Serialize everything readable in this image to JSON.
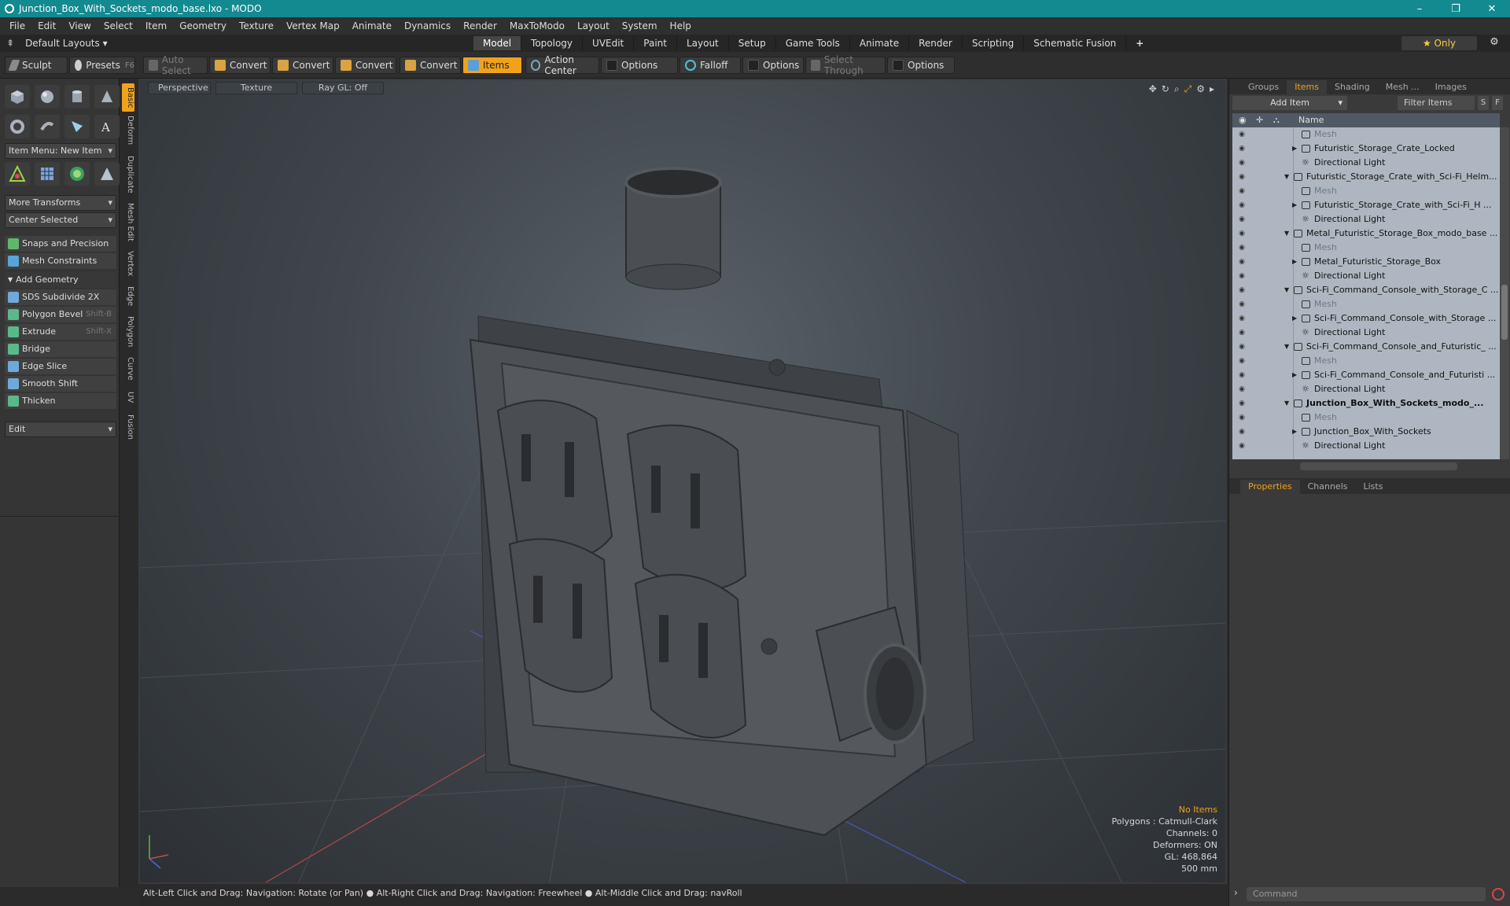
{
  "window": {
    "title": "Junction_Box_With_Sockets_modo_base.lxo - MODO",
    "minimize": "–",
    "maximize": "❐",
    "close": "✕"
  },
  "menu": [
    "File",
    "Edit",
    "View",
    "Select",
    "Item",
    "Geometry",
    "Texture",
    "Vertex Map",
    "Animate",
    "Dynamics",
    "Render",
    "MaxToModo",
    "Layout",
    "System",
    "Help"
  ],
  "layout_bar": {
    "default_layouts": "Default Layouts ▾",
    "tabs": [
      "Model",
      "Topology",
      "UVEdit",
      "Paint",
      "Layout",
      "Setup",
      "Game Tools",
      "Animate",
      "Render",
      "Scripting",
      "Schematic Fusion"
    ],
    "active_tab": "Model",
    "add": "+",
    "only": "★  Only"
  },
  "toolbar": {
    "sculpt": "Sculpt",
    "presets": "Presets",
    "presets_key": "F6",
    "auto_select": "Auto Select",
    "convert1": "Convert",
    "convert2": "Convert",
    "convert3": "Convert",
    "convert4": "Convert",
    "items": "Items",
    "action_center": "Action Center",
    "options1": "Options",
    "falloff": "Falloff",
    "options2": "Options",
    "select_through": "Select Through",
    "options3": "Options"
  },
  "left_panel": {
    "item_menu": "Item Menu: New Item",
    "more_transforms": "More Transforms",
    "center_selected": "Center Selected",
    "snaps": "Snaps and Precision",
    "mesh_constraints": "Mesh Constraints",
    "add_geometry": "Add Geometry",
    "tools": [
      {
        "label": "SDS Subdivide 2X",
        "shortcut": ""
      },
      {
        "label": "Polygon Bevel",
        "shortcut": "Shift-B"
      },
      {
        "label": "Extrude",
        "shortcut": "Shift-X"
      },
      {
        "label": "Bridge",
        "shortcut": ""
      },
      {
        "label": "Edge Slice",
        "shortcut": ""
      },
      {
        "label": "Smooth Shift",
        "shortcut": ""
      },
      {
        "label": "Thicken",
        "shortcut": ""
      }
    ],
    "edit": "Edit"
  },
  "vertical_tabs": [
    "Basic",
    "Deform",
    "Duplicate",
    "Mesh Edit",
    "Vertex",
    "Edge",
    "Polygon",
    "Curve",
    "UV",
    "Fusion"
  ],
  "viewport": {
    "perspective": "Perspective",
    "texture": "Texture",
    "raygl": "Ray GL: Off",
    "info": {
      "no_items": "No Items",
      "polygons": "Polygons : Catmull-Clark",
      "channels": "Channels: 0",
      "deformers": "Deformers: ON",
      "gl": "GL: 468,864",
      "scale": "500 mm"
    }
  },
  "status_bar": "Alt-Left Click and Drag: Navigation: Rotate (or Pan) ● Alt-Right Click and Drag: Navigation: Freewheel ● Alt-Middle Click and Drag: navRoll",
  "right_panel": {
    "tabs": [
      "Groups",
      "Items",
      "Shading",
      "Mesh ...",
      "Images"
    ],
    "active_tab": "Items",
    "add_item": "Add Item",
    "filter": "Filter Items",
    "s_btn": "S",
    "f_btn": "F",
    "name_col": "Name",
    "tree": [
      {
        "label": "Mesh",
        "level": 2,
        "dim": true,
        "type": "mesh"
      },
      {
        "label": "Futuristic_Storage_Crate_Locked",
        "level": 2,
        "arrow": "▶",
        "type": "mesh"
      },
      {
        "label": "Directional Light",
        "level": 2,
        "type": "light"
      },
      {
        "label": "Futuristic_Storage_Crate_with_Sci-Fi_Helm...",
        "level": 1,
        "arrow": "▼",
        "type": "scene"
      },
      {
        "label": "Mesh",
        "level": 2,
        "dim": true,
        "type": "mesh"
      },
      {
        "label": "Futuristic_Storage_Crate_with_Sci-Fi_H ...",
        "level": 2,
        "arrow": "▶",
        "type": "mesh"
      },
      {
        "label": "Directional Light",
        "level": 2,
        "type": "light"
      },
      {
        "label": "Metal_Futuristic_Storage_Box_modo_base ...",
        "level": 1,
        "arrow": "▼",
        "type": "scene"
      },
      {
        "label": "Mesh",
        "level": 2,
        "dim": true,
        "type": "mesh"
      },
      {
        "label": "Metal_Futuristic_Storage_Box",
        "level": 2,
        "arrow": "▶",
        "type": "mesh"
      },
      {
        "label": "Directional Light",
        "level": 2,
        "type": "light"
      },
      {
        "label": "Sci-Fi_Command_Console_with_Storage_C ...",
        "level": 1,
        "arrow": "▼",
        "type": "scene"
      },
      {
        "label": "Mesh",
        "level": 2,
        "dim": true,
        "type": "mesh"
      },
      {
        "label": "Sci-Fi_Command_Console_with_Storage ...",
        "level": 2,
        "arrow": "▶",
        "type": "mesh"
      },
      {
        "label": "Directional Light",
        "level": 2,
        "type": "light"
      },
      {
        "label": "Sci-Fi_Command_Console_and_Futuristic_ ...",
        "level": 1,
        "arrow": "▼",
        "type": "scene"
      },
      {
        "label": "Mesh",
        "level": 2,
        "dim": true,
        "type": "mesh"
      },
      {
        "label": "Sci-Fi_Command_Console_and_Futuristi ...",
        "level": 2,
        "arrow": "▶",
        "type": "mesh"
      },
      {
        "label": "Directional Light",
        "level": 2,
        "type": "light"
      },
      {
        "label": "Junction_Box_With_Sockets_modo_...",
        "level": 1,
        "arrow": "▼",
        "type": "scene",
        "bold": true
      },
      {
        "label": "Mesh",
        "level": 2,
        "dim": true,
        "type": "mesh"
      },
      {
        "label": "Junction_Box_With_Sockets",
        "level": 2,
        "arrow": "▶",
        "type": "mesh"
      },
      {
        "label": "Directional Light",
        "level": 2,
        "type": "light"
      }
    ],
    "prop_tabs": [
      "Properties",
      "Channels",
      "Lists"
    ],
    "prop_active": "Properties",
    "command_placeholder": "Command"
  },
  "colors": {
    "accent": "#f0a21a",
    "titlebar": "#138a90"
  }
}
